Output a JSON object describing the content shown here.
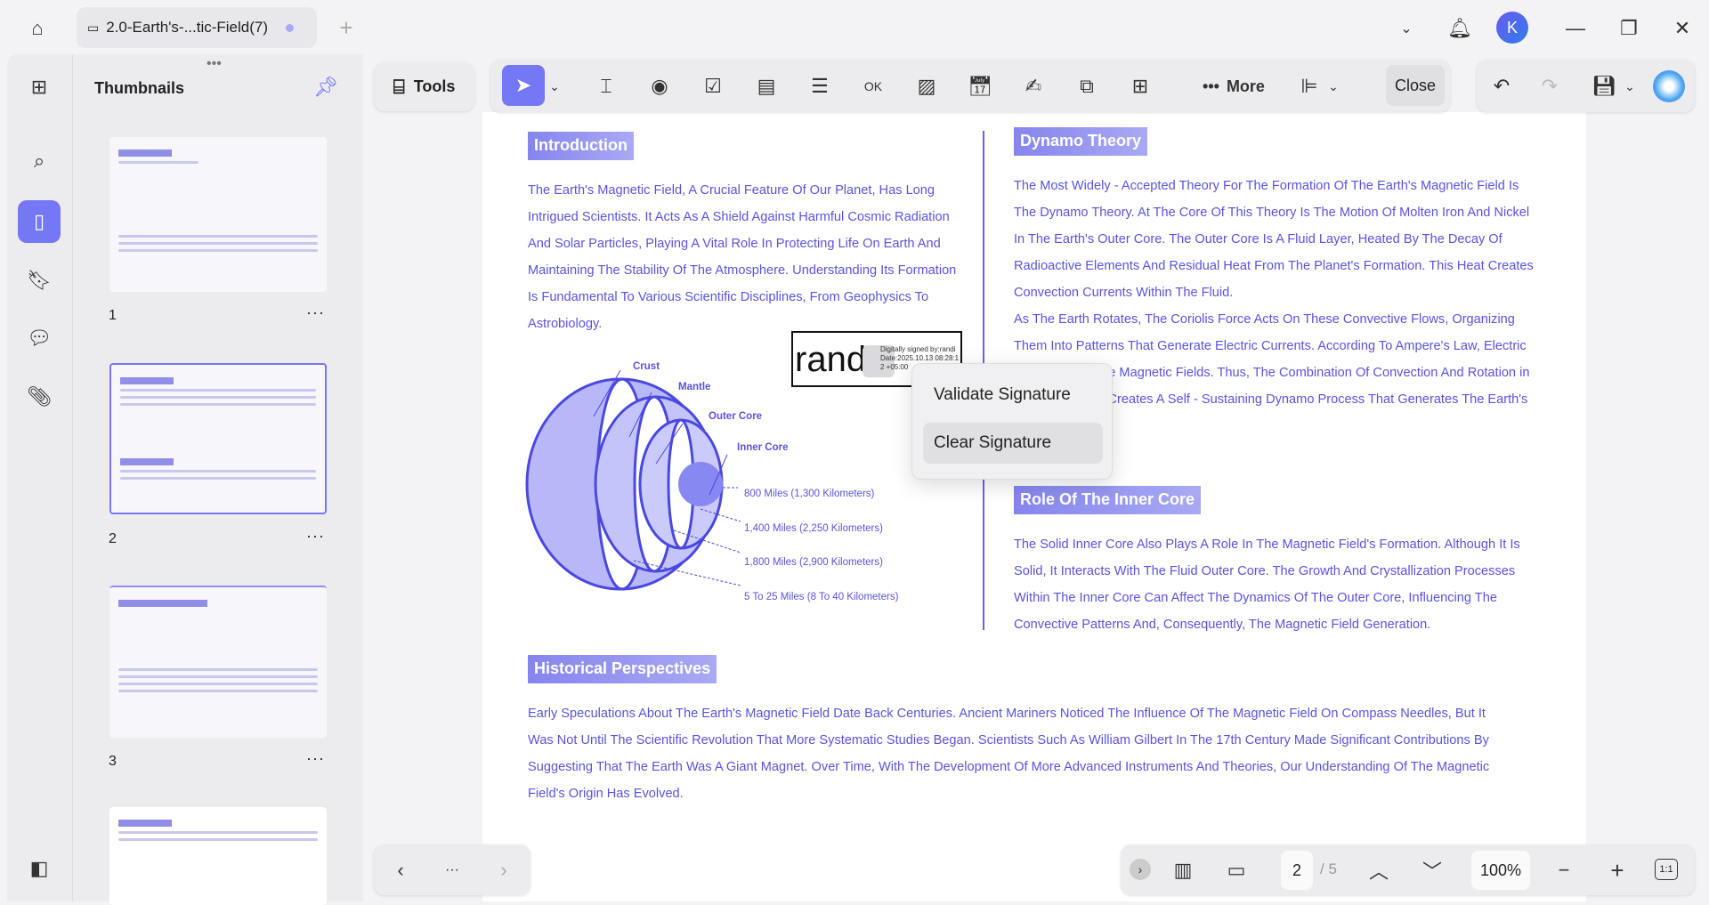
{
  "tab": {
    "title": "2.0-Earth's-...tic-Field(7)"
  },
  "panel": {
    "title": "Thumbnails",
    "pages": [
      "1",
      "2",
      "3"
    ]
  },
  "toolbar": {
    "tools_label": "Tools",
    "more_label": "More",
    "close_label": "Close"
  },
  "document": {
    "intro": {
      "heading": "Introduction",
      "lines": [
        "The Earth's Magnetic Field, A Crucial Feature Of Our Planet, Has Long",
        "Intrigued Scientists. It Acts As A Shield Against Harmful Cosmic Radiation",
        "And Solar Particles, Playing A Vital Role In Protecting Life On Earth And",
        "Maintaining The Stability Of The Atmosphere. Understanding Its Formation",
        "Is Fundamental To Various Scientific Disciplines, From Geophysics To",
        "Astrobiology."
      ]
    },
    "dynamo": {
      "heading": "Dynamo Theory",
      "lines": [
        "The Most Widely - Accepted Theory For The Formation Of The Earth's Magnetic Field Is",
        "The Dynamo Theory. At The Core Of This Theory Is The Motion Of Molten Iron And Nickel",
        "In The Earth's Outer Core. The Outer Core Is A Fluid Layer, Heated By The Decay Of",
        "Radioactive Elements And Residual Heat From The Planet's Formation. This Heat Creates",
        "Convection Currents Within The Fluid.",
        "As The Earth Rotates, The Coriolis Force Acts On These Convective Flows, Organizing",
        "Them Into Patterns That Generate Electric Currents. According To Ampere's Law, Electric",
        "Currents Produce Magnetic Fields. Thus, The Combination Of Convection And Rotation in",
        "The Outer Core Creates A Self - Sustaining Dynamo Process That Generates The Earth's"
      ]
    },
    "inner": {
      "heading": "Role Of The Inner Core",
      "lines": [
        "The Solid Inner Core Also Plays A Role In The Magnetic Field's Formation. Although It Is",
        "Solid, It Interacts With The Fluid Outer Core. The Growth And Crystallization Processes",
        "Within The Inner Core Can Affect The Dynamics Of The Outer Core, Influencing The",
        "Convective Patterns And, Consequently, The Magnetic Field Generation."
      ]
    },
    "history": {
      "heading": "Historical Perspectives",
      "lines": [
        "Early Speculations About The Earth's Magnetic Field Date Back Centuries. Ancient Mariners Noticed The Influence Of The Magnetic Field On Compass Needles, But It",
        "Was Not Until The Scientific Revolution That More Systematic Studies Began. Scientists Such As William Gilbert In The 17th Century Made Significant Contributions By",
        "Suggesting That The Earth Was A Giant Magnet. Over Time, With The Development Of More Advanced Instruments And Theories, Our Understanding Of The Magnetic",
        "Field's Origin Has Evolved."
      ]
    },
    "figure": {
      "crust": "Crust",
      "mantle": "Mantle",
      "outer": "Outer Core",
      "inner": "Inner Core",
      "d1": "800 Miles (1,300 Kilometers)",
      "d2": "1,400 Miles (2,250 Kilometers)",
      "d3": "1,800 Miles (2,900 Kilometers)",
      "d4": "5 To 25 Miles (8 To 40 Kilometers)"
    },
    "signature": {
      "name": "randi",
      "l1": "Digitally signed by:randi",
      "l2": "Date:2025.10.13 08:28:1",
      "l3": "2 +05:00"
    }
  },
  "context_menu": {
    "items": [
      "Validate Signature",
      "Clear Signature"
    ]
  },
  "bottom": {
    "page": "2",
    "total": "/ 5",
    "zoom": "100%",
    "fit": "1:1"
  },
  "avatar": {
    "letter": "K"
  },
  "colors": {
    "accent": "#7478f5",
    "text": "#5b52e0"
  }
}
